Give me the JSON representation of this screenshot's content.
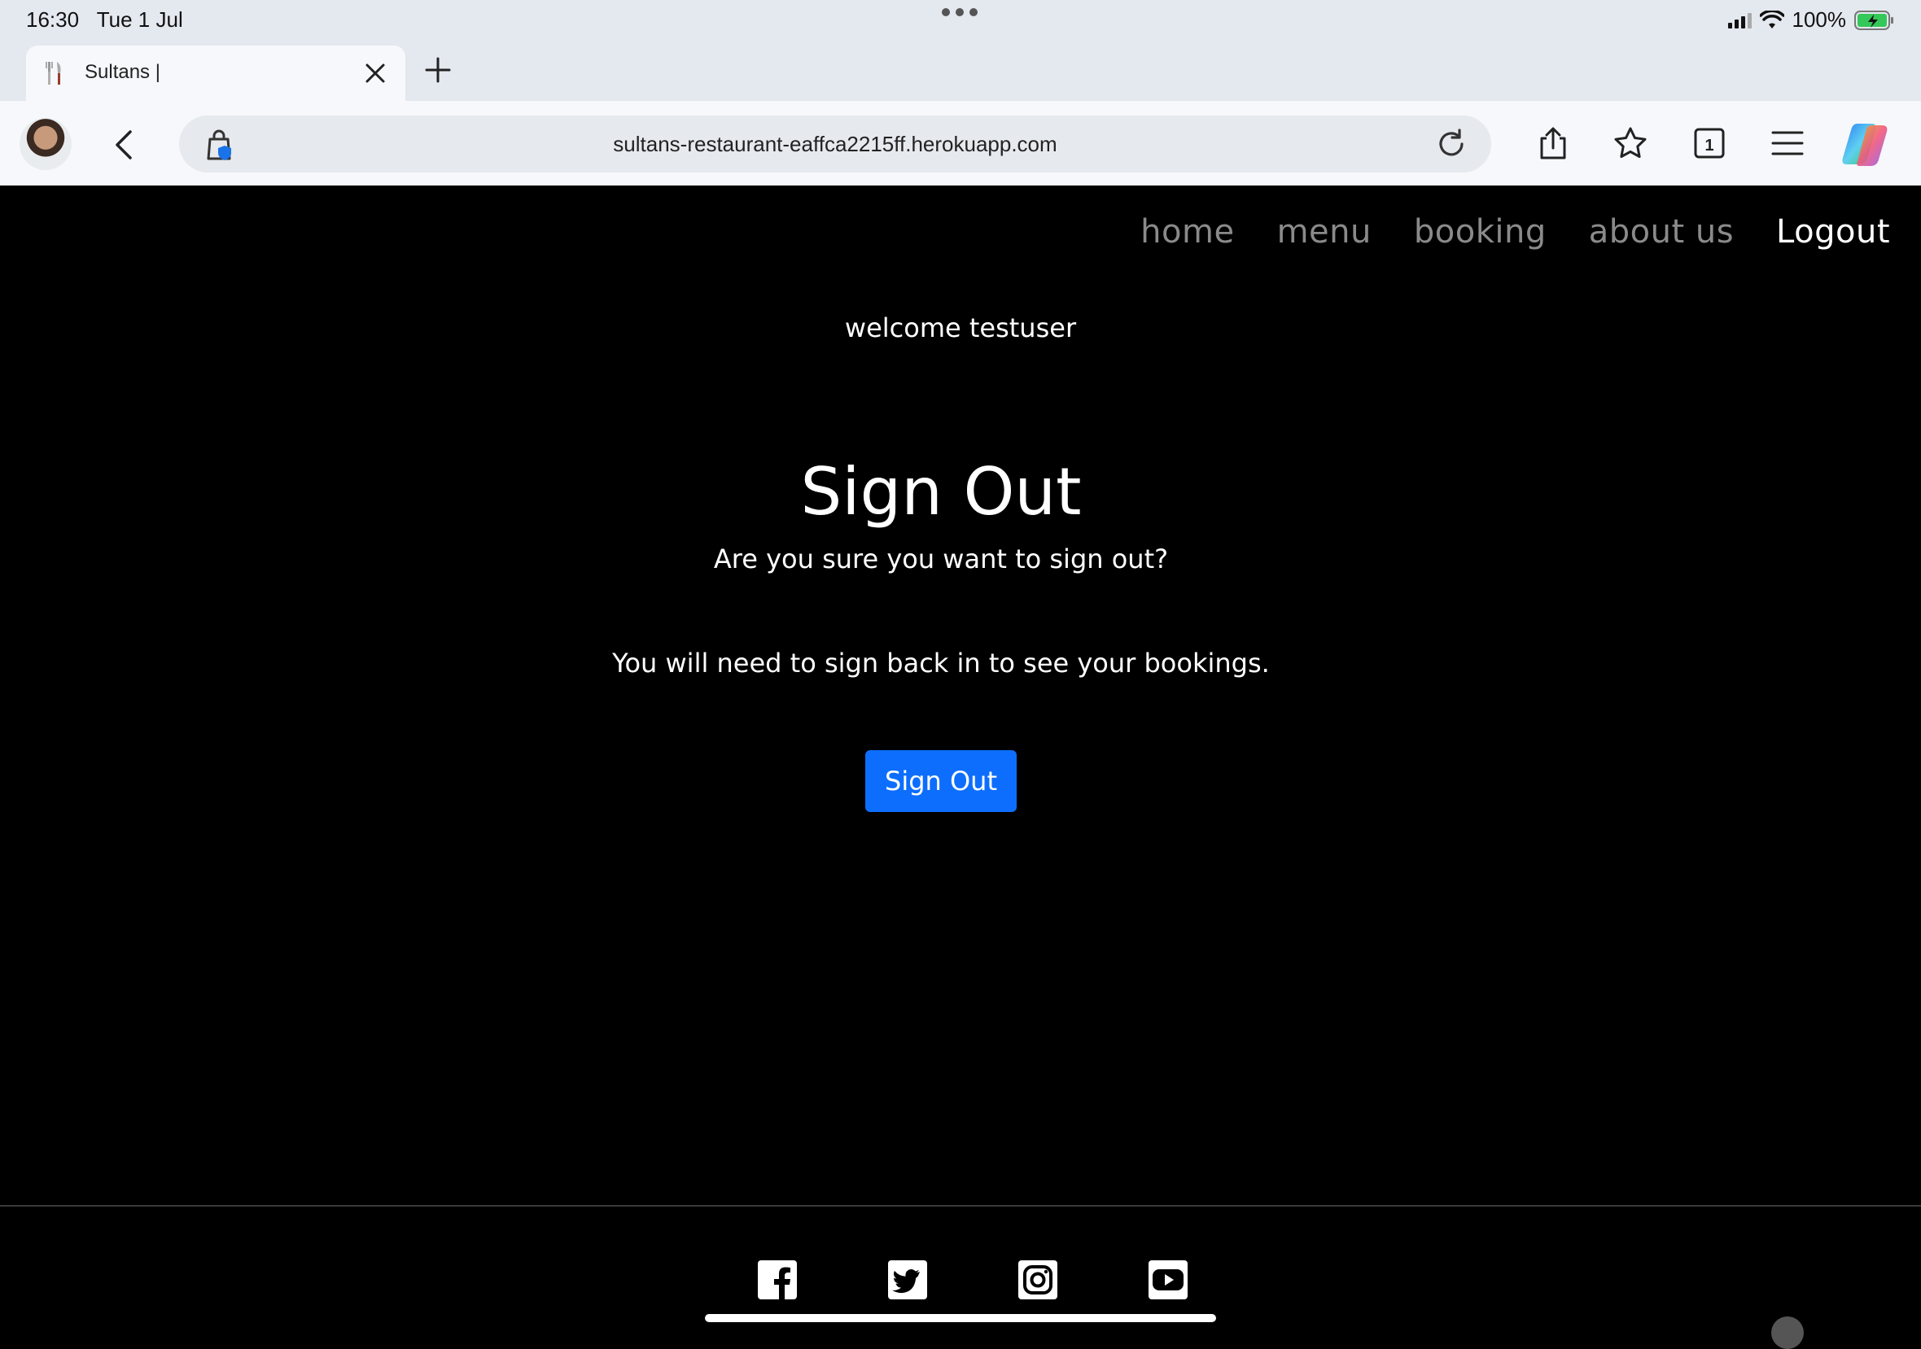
{
  "status_bar": {
    "time": "16:30",
    "date": "Tue 1 Jul",
    "battery": "100%"
  },
  "browser": {
    "tab": {
      "title": "Sultans |"
    },
    "url": "sultans-restaurant-eaffca2215ff.herokuapp.com",
    "tab_count": "1"
  },
  "nav": {
    "home": "home",
    "menu": "menu",
    "booking": "booking",
    "about": "about us",
    "logout": "Logout"
  },
  "content": {
    "welcome": "welcome testuser",
    "heading": "Sign Out",
    "question": "Are you sure you want to sign out?",
    "note": "You will need to sign back in to see your bookings.",
    "button": "Sign Out"
  },
  "footer": {
    "social_icons": [
      "facebook-icon",
      "twitter-icon",
      "instagram-icon",
      "youtube-icon"
    ]
  },
  "colors": {
    "page_background": "#000000",
    "button_primary": "#0d6efd",
    "nav_inactive": "#8a8a8a",
    "nav_active": "#ffffff"
  }
}
